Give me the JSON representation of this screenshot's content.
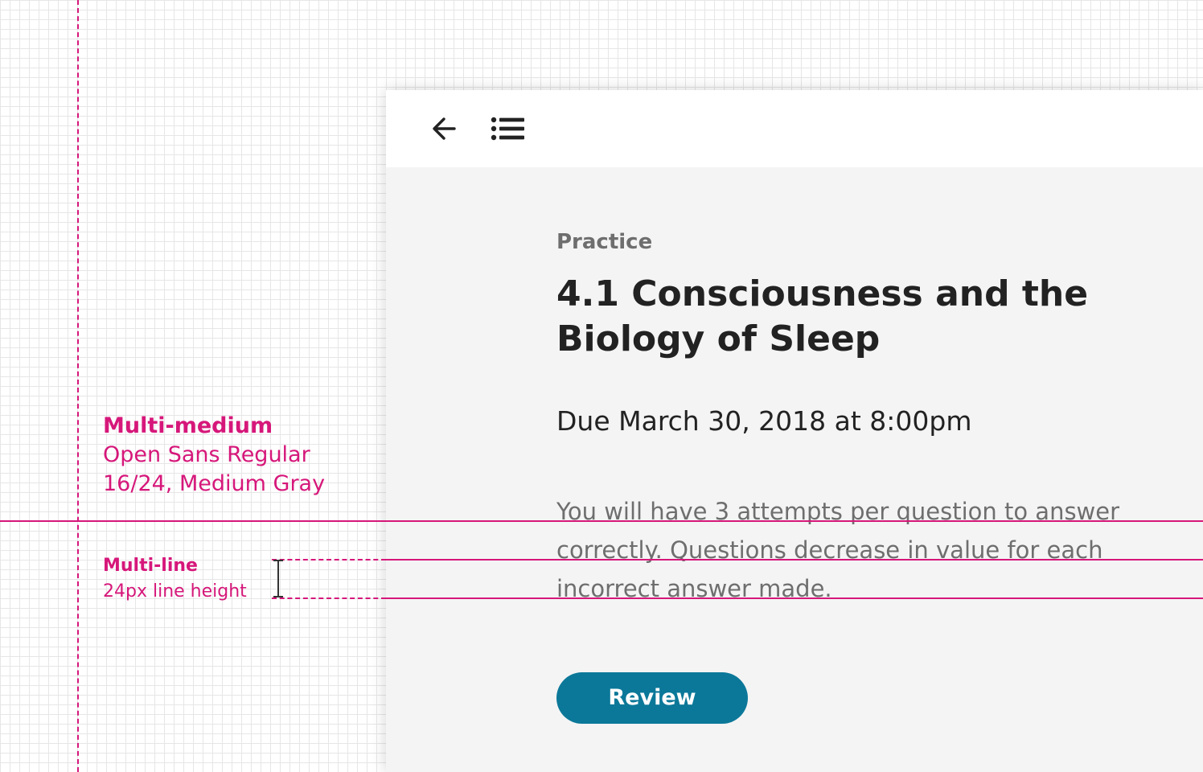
{
  "annotations": {
    "medium": {
      "title": "Multi-medium",
      "font": "Open Sans Regular",
      "spec": "16/24, Medium Gray"
    },
    "line": {
      "title": "Multi-line",
      "spec": "24px line height"
    },
    "color": "#d6177a"
  },
  "topbar": {
    "back_icon": "arrow-left-icon",
    "menu_icon": "list-icon"
  },
  "content": {
    "category": "Practice",
    "title": "4.1 Consciousness and the Biology of Sleep",
    "due": "Due March 30, 2018 at 8:00pm",
    "description": "You will have 3 attempts per question to answer correctly. Questions decrease in value for each incorrect answer made.",
    "review_label": "Review"
  },
  "colors": {
    "accent": "#0b7899",
    "panel": "#f4f4f4",
    "medium_gray": "#6e6e6e",
    "dark_text": "#222222"
  }
}
